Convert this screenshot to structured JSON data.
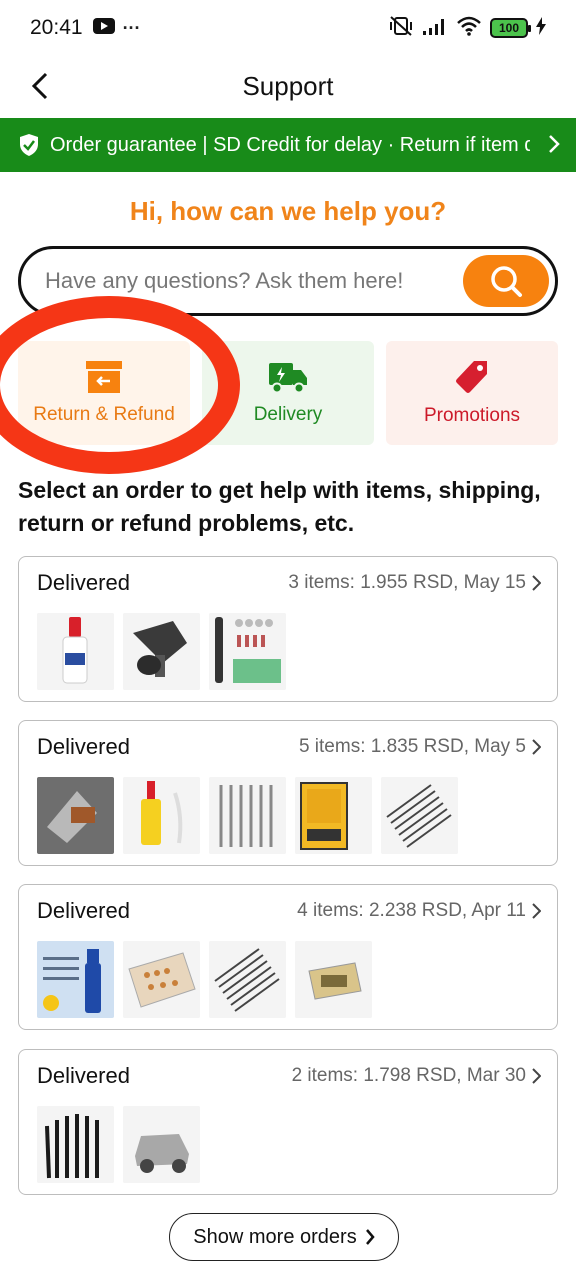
{
  "status_bar": {
    "time": "20:41",
    "dots": "···",
    "battery": "100"
  },
  "header": {
    "title": "Support"
  },
  "banner": {
    "text": "Order guarantee | SD Credit for delay · Return if item damaged"
  },
  "greeting": "Hi, how can we help you?",
  "search": {
    "placeholder": "Have any questions? Ask them here!"
  },
  "categories": [
    {
      "label": "Return & Refund",
      "icon": "return-box-icon",
      "color": "#e87a14"
    },
    {
      "label": "Delivery",
      "icon": "delivery-truck-icon",
      "color": "#1f8a23"
    },
    {
      "label": "Promotions",
      "icon": "price-tag-icon",
      "color": "#cc1a2a"
    }
  ],
  "instructions": "Select an order to get help with items, shipping, return or refund problems, etc.",
  "orders": [
    {
      "status": "Delivered",
      "summary": "3 items: 1.955 RSD, May 15",
      "thumbs": [
        "super-glue-bottle",
        "phone-car-holder",
        "rotary-tool-kit"
      ]
    },
    {
      "status": "Delivered",
      "summary": "5 items: 1.835 RSD, May 5",
      "thumbs": [
        "model-parts",
        "welding-glue",
        "sculpting-tools",
        "panzer-parking-sign",
        "steel-needles"
      ]
    },
    {
      "status": "Delivered",
      "summary": "4 items: 2.238 RSD, Apr 11",
      "thumbs": [
        "glue-adhesive-ad",
        "bead-kit-box",
        "steel-needles",
        "model-tank-kit"
      ]
    },
    {
      "status": "Delivered",
      "summary": "2 items: 1.798 RSD, Mar 30",
      "thumbs": [
        "paint-brushes",
        "model-car-kit"
      ]
    }
  ],
  "show_more": "Show more orders",
  "colors": {
    "banner_green": "#188b19",
    "accent_orange": "#f7820f",
    "annotation_red": "#f53616"
  }
}
